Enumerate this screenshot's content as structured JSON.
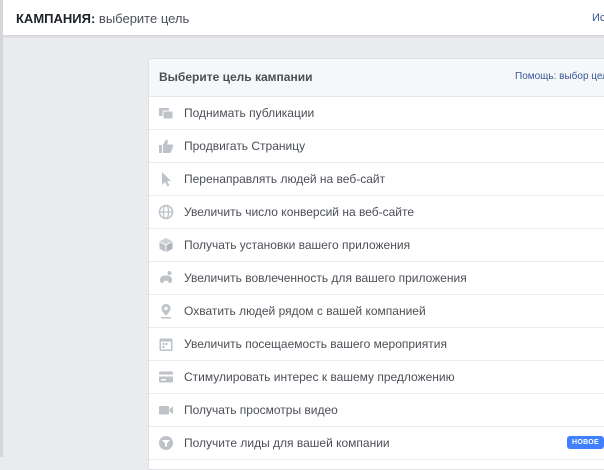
{
  "header": {
    "title_strong": "КАМПАНИЯ:",
    "title_rest": " выберите цель",
    "right_link": "Ис"
  },
  "panel": {
    "title": "Выберите цель кампании",
    "help_link": "Помощь: выбор цели"
  },
  "objectives": [
    {
      "label": "Поднимать публикации",
      "icon": "boost-posts-icon"
    },
    {
      "label": "Продвигать Страницу",
      "icon": "thumbs-up-icon"
    },
    {
      "label": "Перенаправлять людей на веб-сайт",
      "icon": "cursor-icon"
    },
    {
      "label": "Увеличить число конверсий на веб-сайте",
      "icon": "globe-icon"
    },
    {
      "label": "Получать установки вашего приложения",
      "icon": "box-icon"
    },
    {
      "label": "Увеличить вовлеченность для вашего приложения",
      "icon": "joystick-icon"
    },
    {
      "label": "Охватить людей рядом с вашей компанией",
      "icon": "location-pin-icon"
    },
    {
      "label": "Увеличить посещаемость вашего мероприятия",
      "icon": "calendar-icon"
    },
    {
      "label": "Стимулировать интерес к вашему предложению",
      "icon": "offer-icon"
    },
    {
      "label": "Получать просмотры видео",
      "icon": "video-camera-icon"
    },
    {
      "label": "Получите лиды для вашей компании",
      "icon": "funnel-icon",
      "badge": "НОВОЕ"
    }
  ],
  "colors": {
    "background": "#e9ebee",
    "text": "#4b4f56",
    "icon": "#bec2c9",
    "link": "#365899",
    "badge": "#4080ff"
  }
}
